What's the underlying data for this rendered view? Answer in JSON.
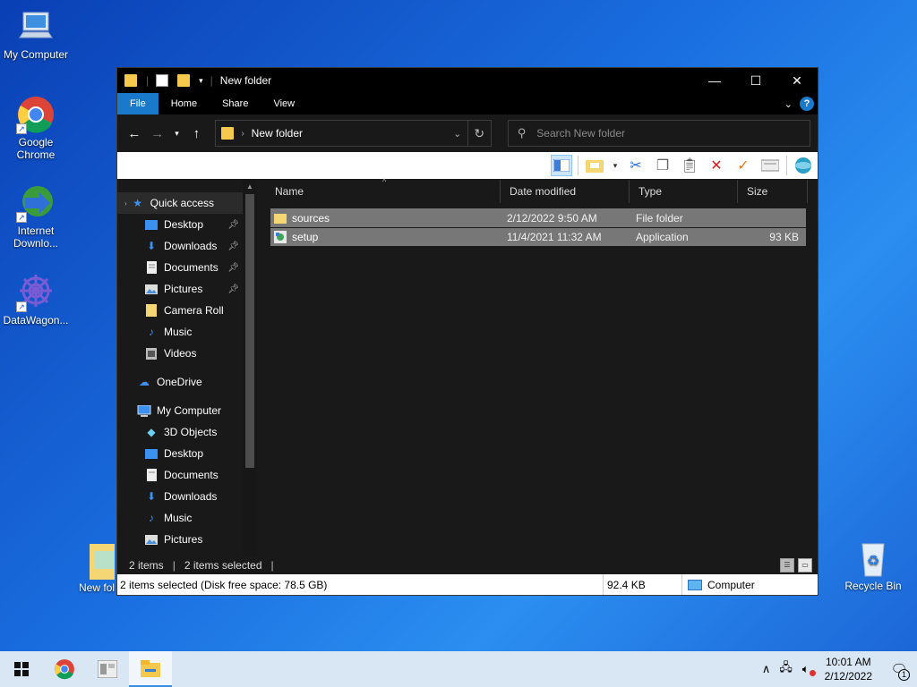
{
  "desktop": {
    "icons": [
      {
        "label": "My Computer"
      },
      {
        "label": "Google Chrome"
      },
      {
        "label": "Internet Downlo..."
      },
      {
        "label": "DataWagon..."
      },
      {
        "label": "New fol"
      },
      {
        "label": "Recycle Bin"
      }
    ]
  },
  "window": {
    "title": "New folder",
    "ribbon_tabs": [
      "File",
      "Home",
      "Share",
      "View"
    ],
    "address": "New folder",
    "search_placeholder": "Search New folder",
    "nav": {
      "quick_access": "Quick access",
      "qa_items": [
        "Desktop",
        "Downloads",
        "Documents",
        "Pictures",
        "Camera Roll",
        "Music",
        "Videos"
      ],
      "onedrive": "OneDrive",
      "my_computer": "My Computer",
      "pc_items": [
        "3D Objects",
        "Desktop",
        "Documents",
        "Downloads",
        "Music",
        "Pictures"
      ]
    },
    "columns": [
      "Name",
      "Date modified",
      "Type",
      "Size"
    ],
    "files": [
      {
        "name": "sources",
        "date": "2/12/2022 9:50 AM",
        "type": "File folder",
        "size": ""
      },
      {
        "name": "setup",
        "date": "11/4/2021 11:32 AM",
        "type": "Application",
        "size": "93 KB"
      }
    ],
    "status": {
      "count": "2 items",
      "selected": "2 items selected"
    },
    "bottom": {
      "info": "2 items selected (Disk free space: 78.5 GB)",
      "size": "92.4 KB",
      "location": "Computer"
    }
  },
  "taskbar": {
    "time": "10:01 AM",
    "date": "2/12/2022",
    "notification_count": "1"
  },
  "colors": {
    "accent": "#1979ca",
    "selection": "#777777",
    "folder": "#f4c94e"
  }
}
